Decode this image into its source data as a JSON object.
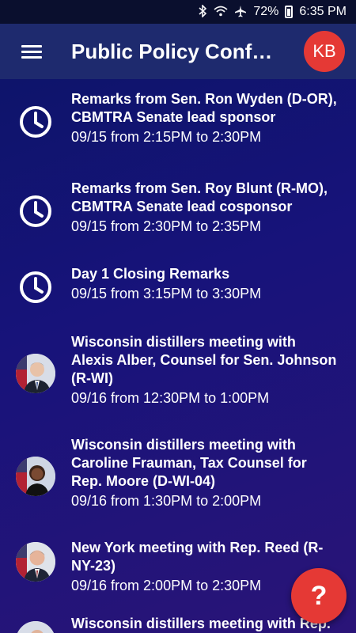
{
  "status_bar": {
    "battery": "72%",
    "time": "6:35 PM",
    "icons": [
      "bluetooth-icon",
      "wifi-icon",
      "airplane-icon",
      "battery-icon"
    ]
  },
  "app_bar": {
    "title": "Public Policy Confer…",
    "user_initials": "KB",
    "menu_icon": "hamburger-menu-icon"
  },
  "items": [
    {
      "icon": "clock-icon",
      "title": "Remarks from Sen. Ron Wyden (D-OR), CBMTRA Senate lead sponsor",
      "time": "09/15 from 2:15PM to 2:30PM"
    },
    {
      "icon": "clock-icon",
      "title": "Remarks from Sen. Roy Blunt (R-MO), CBMTRA Senate lead cosponsor",
      "time": "09/15 from 2:30PM to 2:35PM"
    },
    {
      "icon": "clock-icon",
      "title": "Day 1 Closing Remarks",
      "time": "09/15 from 3:15PM to 3:30PM"
    },
    {
      "icon": "person-photo",
      "title": "Wisconsin distillers meeting with Alexis Alber, Counsel for Sen. Johnson (R-WI)",
      "time": "09/16 from 12:30PM to 1:00PM"
    },
    {
      "icon": "person-photo",
      "title": "Wisconsin distillers meeting with Caroline Frauman, Tax Counsel for Rep. Moore (D-WI-04)",
      "time": "09/16 from 1:30PM to 2:00PM"
    },
    {
      "icon": "person-photo",
      "title": "New York meeting with Rep. Reed (R-NY-23)",
      "time": "09/16 from 2:00PM to 2:30PM"
    },
    {
      "icon": "person-photo",
      "title": "Wisconsin distillers meeting with Rep.",
      "time": ""
    }
  ],
  "fab": {
    "label": "?",
    "icon": "help-icon"
  },
  "colors": {
    "accent": "#e53935",
    "app_bar": "#1e2a6e",
    "background": "#17137a"
  }
}
